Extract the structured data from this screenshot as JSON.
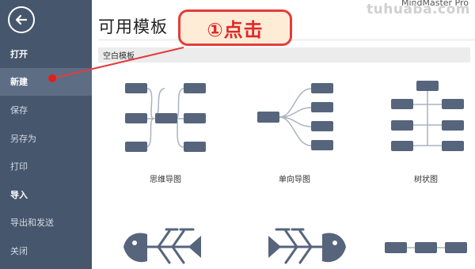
{
  "app": {
    "name": "MindMaster Pro",
    "watermark": "tuhuaba.com"
  },
  "sidebar": {
    "back_icon": "arrow-left-icon",
    "items": [
      {
        "label": "打开"
      },
      {
        "label": "新建"
      },
      {
        "label": "保存"
      },
      {
        "label": "另存为"
      },
      {
        "label": "打印"
      },
      {
        "label": "导入"
      },
      {
        "label": "导出和发送"
      },
      {
        "label": "关闭"
      }
    ]
  },
  "main": {
    "title": "可用模板",
    "section": "空白模板",
    "templates": [
      {
        "label": "思维导图",
        "icon": "mind-map-icon"
      },
      {
        "label": "单向导图",
        "icon": "right-map-icon"
      },
      {
        "label": "树状图",
        "icon": "tree-map-icon"
      },
      {
        "label": "",
        "icon": "fishbone-left-icon"
      },
      {
        "label": "",
        "icon": "fishbone-right-icon"
      },
      {
        "label": "",
        "icon": "timeline-icon"
      }
    ]
  },
  "annotation": {
    "text": "①点击"
  },
  "colors": {
    "sidebar_bg": "#46566c",
    "sidebar_active": "#5c6d84",
    "node": "#56657c",
    "connector": "#a9b3bf",
    "callout_border": "#e43c3c",
    "callout_fill": "#ffecd6",
    "callout_text": "#e12828"
  }
}
